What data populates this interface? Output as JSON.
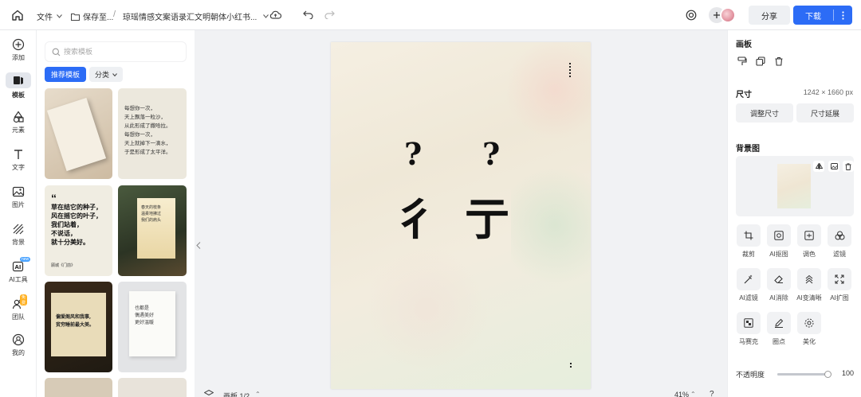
{
  "topbar": {
    "file_label": "文件",
    "save_label": "保存至...",
    "separator": "/",
    "doc_title": "琼瑶情感文案语录汇文明朝体小红书...",
    "share_label": "分享",
    "download_label": "下载"
  },
  "leftnav": {
    "items": [
      {
        "label": "添加",
        "icon": "plus-circle-icon"
      },
      {
        "label": "模板",
        "icon": "template-icon"
      },
      {
        "label": "元素",
        "icon": "shapes-icon"
      },
      {
        "label": "文字",
        "icon": "text-icon"
      },
      {
        "label": "图片",
        "icon": "image-icon"
      },
      {
        "label": "背景",
        "icon": "background-icon"
      },
      {
        "label": "AI工具",
        "icon": "ai-icon",
        "badge": "new"
      },
      {
        "label": "团队",
        "icon": "team-icon",
        "badge": "免费"
      },
      {
        "label": "我的",
        "icon": "user-icon"
      }
    ]
  },
  "panel": {
    "search_placeholder": "搜索模板",
    "tab_recommended": "推荐模板",
    "tab_category": "分类"
  },
  "templates": [
    {
      "lines": []
    },
    {
      "lines": [
        "每想你一次，",
        "天上飘落一粒沙，",
        "从此形成了撒哈拉。",
        "每想你一次，",
        "天上就掉下一滴水，",
        "于是形成了太平洋。"
      ]
    },
    {
      "lines": [
        "草在结它的种子，",
        "风在摇它的叶子，",
        "我们站着，",
        "不说话，",
        "就十分美好。"
      ],
      "quote_mark": "“",
      "author": "顾城《门前》"
    },
    {
      "lines": [
        "春天的枝条",
        "温柔地拂过",
        "我们的肩头"
      ]
    },
    {
      "lines": [
        "偏爱阁风和我事,",
        "贫穷睡前最大美。"
      ]
    },
    {
      "lines": [
        "也都是",
        "偶遇美好",
        "更好温暖"
      ]
    }
  ],
  "canvas": {
    "glyph_q1": "?",
    "glyph_q2": "?",
    "glyph_char1": "彳",
    "glyph_char2": "亍",
    "page_label": "画板 1/2",
    "zoom": "41%",
    "help": "?"
  },
  "right": {
    "artboard_title": "画板",
    "size_title": "尺寸",
    "size_value": "1242 × 1660 px",
    "resize_label": "调整尺寸",
    "extend_label": "尺寸延展",
    "bg_title": "背景图",
    "tools": [
      {
        "label": "裁剪",
        "icon": "crop-icon"
      },
      {
        "label": "AI抠图",
        "icon": "cutout-icon"
      },
      {
        "label": "调色",
        "icon": "adjust-color-icon"
      },
      {
        "label": "滤镜",
        "icon": "filter-icon"
      },
      {
        "label": "AI滤镜",
        "icon": "ai-filter-icon"
      },
      {
        "label": "AI消除",
        "icon": "eraser-icon"
      },
      {
        "label": "AI变清晰",
        "icon": "sharpen-icon"
      },
      {
        "label": "AI扩图",
        "icon": "expand-icon"
      },
      {
        "label": "马赛克",
        "icon": "mosaic-icon"
      },
      {
        "label": "圈点",
        "icon": "pen-icon"
      },
      {
        "label": "美化",
        "icon": "beautify-icon"
      }
    ],
    "opacity_label": "不透明度",
    "opacity_value": "100",
    "opacity_level": 1.0
  },
  "colors": {
    "accent": "#2c6cf6",
    "tab_bg": "#2c6cf6"
  }
}
